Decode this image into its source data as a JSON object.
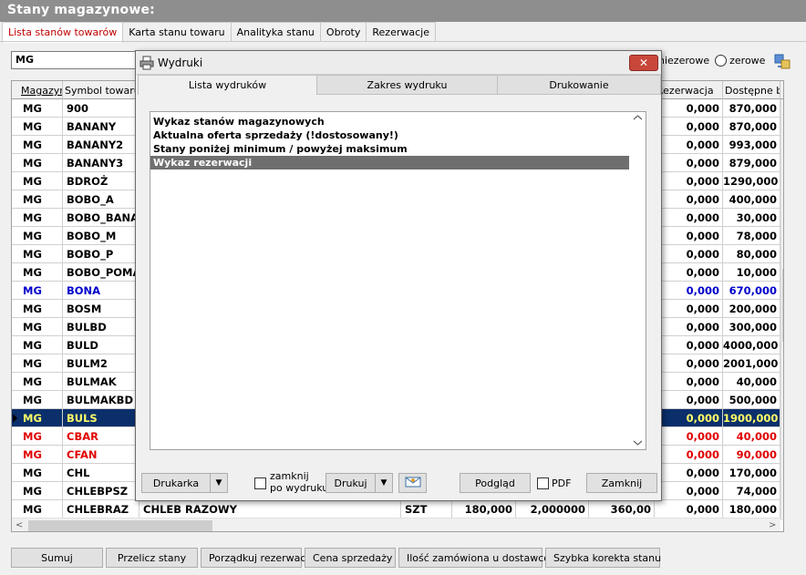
{
  "window": {
    "title": "Stany magazynowe:"
  },
  "tabs": [
    "Lista stanów towarów",
    "Karta stanu towaru",
    "Analityka stanu",
    "Obroty",
    "Rezerwacje"
  ],
  "filter": {
    "value": "MG"
  },
  "radio": {
    "nonzero": "niezerowe",
    "zero": "zerowe"
  },
  "grid": {
    "headers": {
      "mag": "Magazyn",
      "sym": "Symbol towaru",
      "rez": "Rezerwacja",
      "dost": "Dostępne bez"
    },
    "rows": [
      {
        "mag": "MG",
        "sym": "900",
        "name": "",
        "unit": "",
        "q1": "",
        "q2": "",
        "q3": "",
        "rez": "0,000",
        "dost": "870,000",
        "style": ""
      },
      {
        "mag": "MG",
        "sym": "BANANY",
        "name": "",
        "unit": "",
        "q1": "",
        "q2": "",
        "q3": "",
        "rez": "0,000",
        "dost": "870,000",
        "style": ""
      },
      {
        "mag": "MG",
        "sym": "BANANY2",
        "name": "",
        "unit": "",
        "q1": "",
        "q2": "",
        "q3": "",
        "rez": "0,000",
        "dost": "993,000",
        "style": ""
      },
      {
        "mag": "MG",
        "sym": "BANANY3",
        "name": "",
        "unit": "",
        "q1": "",
        "q2": "",
        "q3": "",
        "rez": "0,000",
        "dost": "879,000",
        "style": ""
      },
      {
        "mag": "MG",
        "sym": "BDROŻ",
        "name": "",
        "unit": "",
        "q1": "",
        "q2": "",
        "q3": "",
        "rez": "0,000",
        "dost": "1290,000",
        "style": ""
      },
      {
        "mag": "MG",
        "sym": "BOBO_A",
        "name": "",
        "unit": "",
        "q1": "",
        "q2": "",
        "q3": "",
        "rez": "0,000",
        "dost": "400,000",
        "style": ""
      },
      {
        "mag": "MG",
        "sym": "BOBO_BANA",
        "name": "",
        "unit": "",
        "q1": "",
        "q2": "",
        "q3": "",
        "rez": "0,000",
        "dost": "30,000",
        "style": ""
      },
      {
        "mag": "MG",
        "sym": "BOBO_M",
        "name": "",
        "unit": "",
        "q1": "",
        "q2": "",
        "q3": "",
        "rez": "0,000",
        "dost": "78,000",
        "style": ""
      },
      {
        "mag": "MG",
        "sym": "BOBO_P",
        "name": "",
        "unit": "",
        "q1": "",
        "q2": "",
        "q3": "",
        "rez": "0,000",
        "dost": "80,000",
        "style": ""
      },
      {
        "mag": "MG",
        "sym": "BOBO_POMA",
        "name": "",
        "unit": "",
        "q1": "",
        "q2": "",
        "q3": "",
        "rez": "0,000",
        "dost": "10,000",
        "style": ""
      },
      {
        "mag": "MG",
        "sym": "BONA",
        "name": "",
        "unit": "",
        "q1": "",
        "q2": "",
        "q3": "",
        "rez": "0,000",
        "dost": "670,000",
        "style": "blue"
      },
      {
        "mag": "MG",
        "sym": "BOSM",
        "name": "",
        "unit": "",
        "q1": "",
        "q2": "",
        "q3": "",
        "rez": "0,000",
        "dost": "200,000",
        "style": ""
      },
      {
        "mag": "MG",
        "sym": "BULBD",
        "name": "",
        "unit": "",
        "q1": "",
        "q2": "",
        "q3": "",
        "rez": "0,000",
        "dost": "300,000",
        "style": ""
      },
      {
        "mag": "MG",
        "sym": "BULD",
        "name": "",
        "unit": "",
        "q1": "",
        "q2": "",
        "q3": "",
        "rez": "0,000",
        "dost": "4000,000",
        "style": ""
      },
      {
        "mag": "MG",
        "sym": "BULM2",
        "name": "",
        "unit": "",
        "q1": "",
        "q2": "",
        "q3": "",
        "rez": "0,000",
        "dost": "2001,000",
        "style": ""
      },
      {
        "mag": "MG",
        "sym": "BULMAK",
        "name": "",
        "unit": "",
        "q1": "",
        "q2": "",
        "q3": "",
        "rez": "0,000",
        "dost": "40,000",
        "style": ""
      },
      {
        "mag": "MG",
        "sym": "BULMAKBD",
        "name": "",
        "unit": "",
        "q1": "",
        "q2": "",
        "q3": "",
        "rez": "0,000",
        "dost": "500,000",
        "style": ""
      },
      {
        "mag": "MG",
        "sym": "BULS",
        "name": "",
        "unit": "",
        "q1": "",
        "q2": "",
        "q3": "",
        "rez": "0,000",
        "dost": "1900,000",
        "style": "selected"
      },
      {
        "mag": "MG",
        "sym": "CBAR",
        "name": "",
        "unit": "",
        "q1": "",
        "q2": "",
        "q3": "",
        "rez": "0,000",
        "dost": "40,000",
        "style": "red"
      },
      {
        "mag": "MG",
        "sym": "CFAN",
        "name": "",
        "unit": "",
        "q1": "",
        "q2": "",
        "q3": "",
        "rez": "0,000",
        "dost": "90,000",
        "style": "red"
      },
      {
        "mag": "MG",
        "sym": "CHL",
        "name": "",
        "unit": "",
        "q1": "",
        "q2": "",
        "q3": "",
        "rez": "0,000",
        "dost": "170,000",
        "style": ""
      },
      {
        "mag": "MG",
        "sym": "CHLEBPSZ",
        "name": "",
        "unit": "",
        "q1": "",
        "q2": "",
        "q3": "",
        "rez": "0,000",
        "dost": "74,000",
        "style": ""
      },
      {
        "mag": "MG",
        "sym": "CHLEBRAZ",
        "name": "CHLEB RAZOWY",
        "unit": "SZT",
        "q1": "180,000",
        "q2": "2,000000",
        "q3": "360,00",
        "rez": "0,000",
        "dost": "180,000",
        "style": ""
      }
    ]
  },
  "bottom_buttons": [
    "Sumuj",
    "Przelicz stany",
    "Porządkuj rezerwacje",
    "Cena sprzedaży",
    "Ilość zamówiona u dostawców",
    "Szybka korekta stanu"
  ],
  "dialog": {
    "title": "Wydruki",
    "close_label": "✕",
    "tabs": [
      "Lista wydruków",
      "Zakres wydruku",
      "Drukowanie"
    ],
    "items": [
      {
        "label": "Wykaz stanów magazynowych",
        "selected": false
      },
      {
        "label": "Aktualna oferta sprzedaży (!dostosowany!)",
        "selected": false
      },
      {
        "label": "Stany poniżej minimum / powyżej maksimum",
        "selected": false
      },
      {
        "label": "Wykaz rezerwacji",
        "selected": true
      }
    ],
    "footer": {
      "printer": "Drukarka",
      "close_after_line1": "zamknij",
      "close_after_line2": "po wydruku",
      "print": "Drukuj",
      "preview": "Podgląd",
      "pdf": "PDF",
      "close": "Zamknij"
    }
  },
  "colors": {
    "selected_row_bg": "#0a2f6b",
    "selected_row_fg": "#ffff66",
    "red_row": "#e00000",
    "blue_row": "#0000cc",
    "title_bg": "#8e8e8e"
  }
}
